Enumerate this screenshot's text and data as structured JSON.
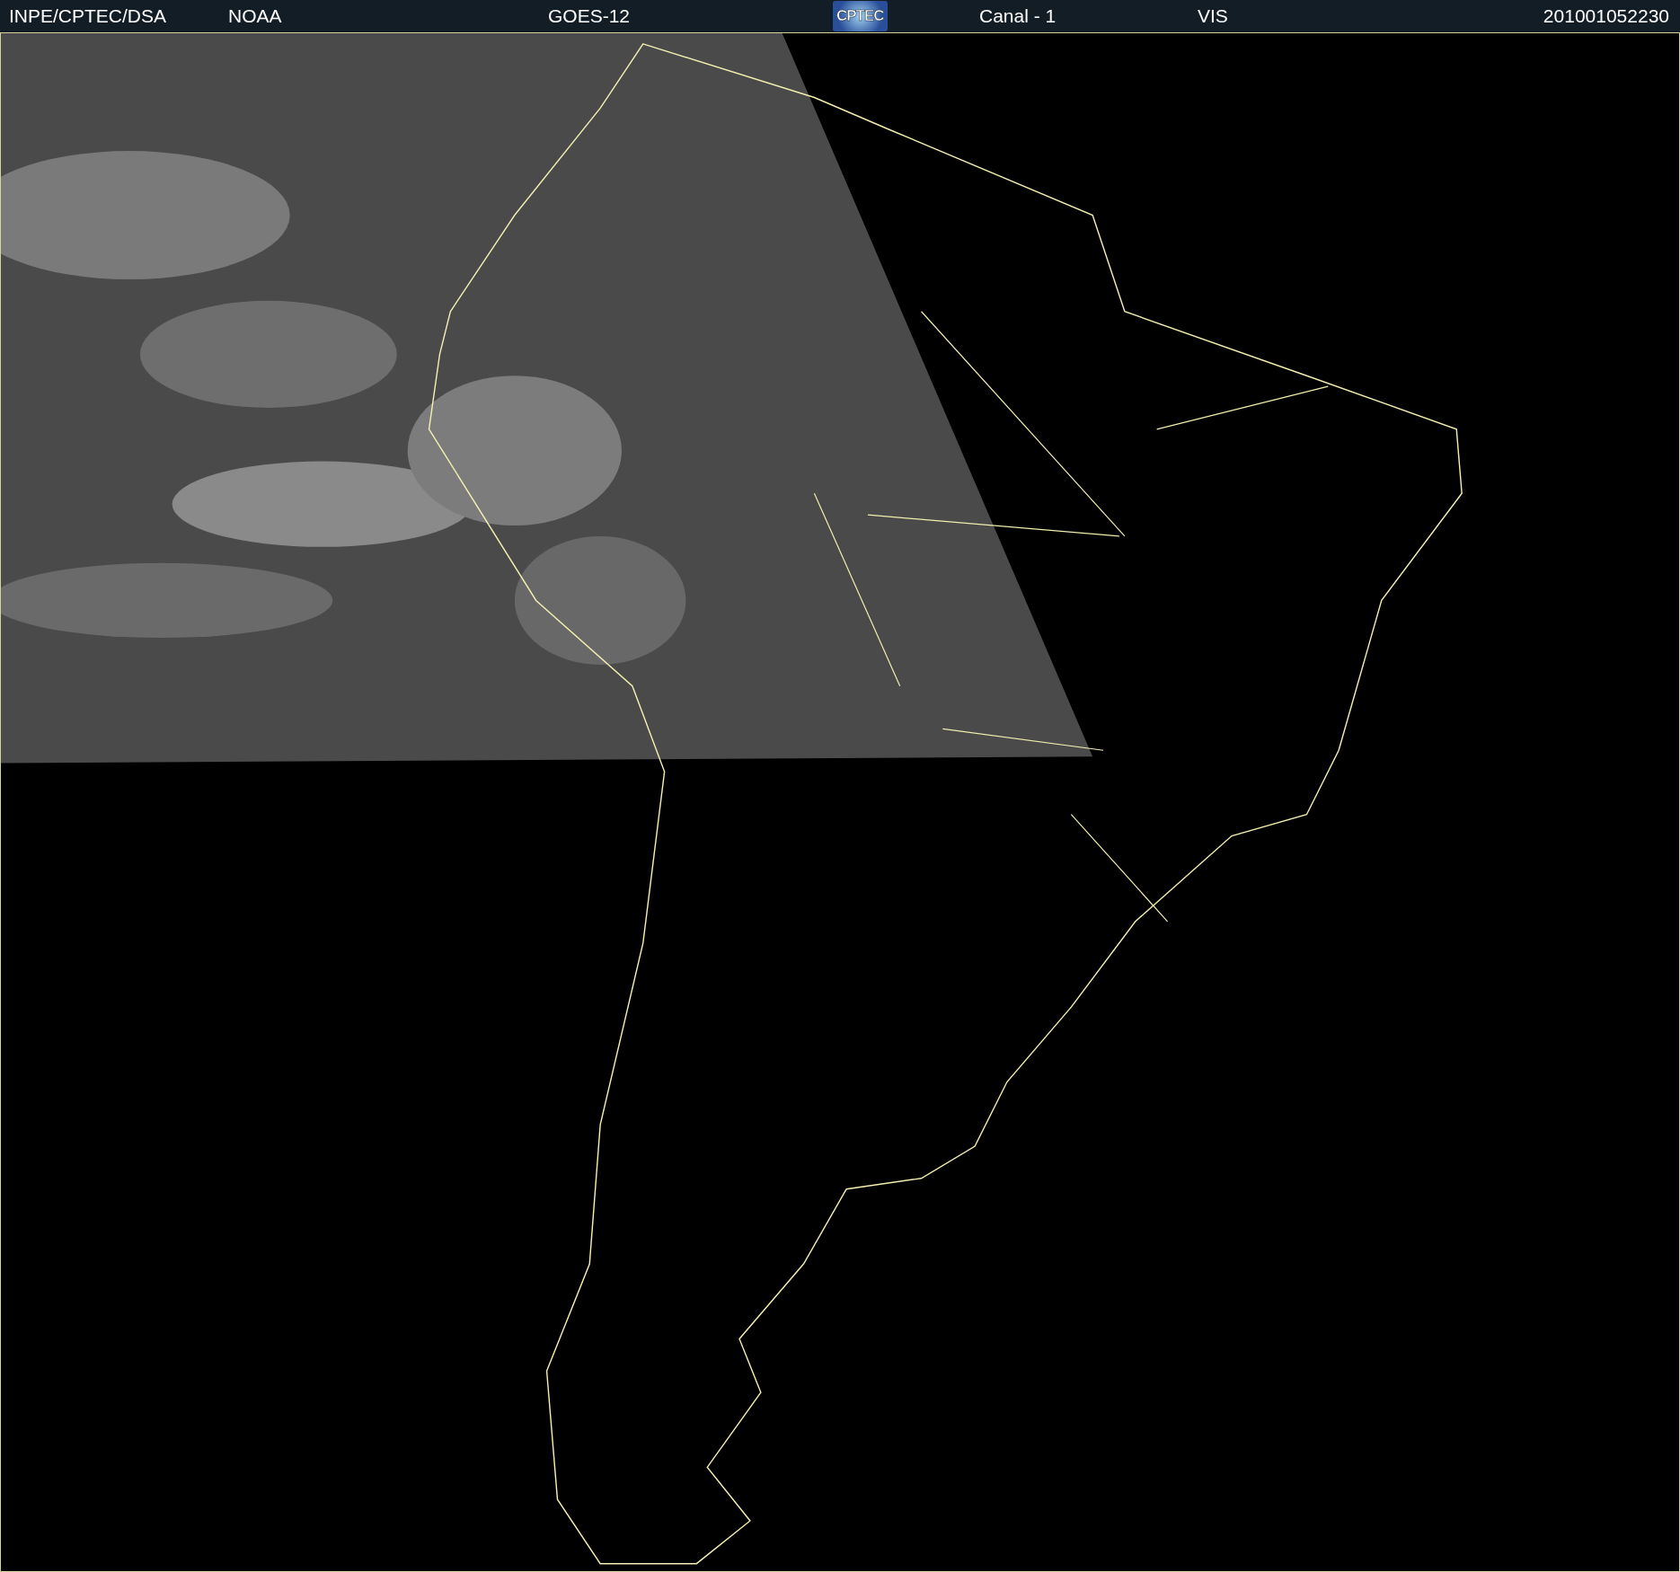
{
  "header": {
    "items": [
      {
        "kind": "text",
        "text": "INPE/CPTEC/DSA"
      },
      {
        "kind": "text",
        "text": "NOAA"
      },
      {
        "kind": "text",
        "text": "GOES-12"
      },
      {
        "kind": "logo",
        "text": "CPTEC"
      },
      {
        "kind": "text",
        "text": "Canal - 1"
      },
      {
        "kind": "text",
        "text": "VIS"
      },
      {
        "kind": "text",
        "text": "201001052230"
      }
    ]
  }
}
